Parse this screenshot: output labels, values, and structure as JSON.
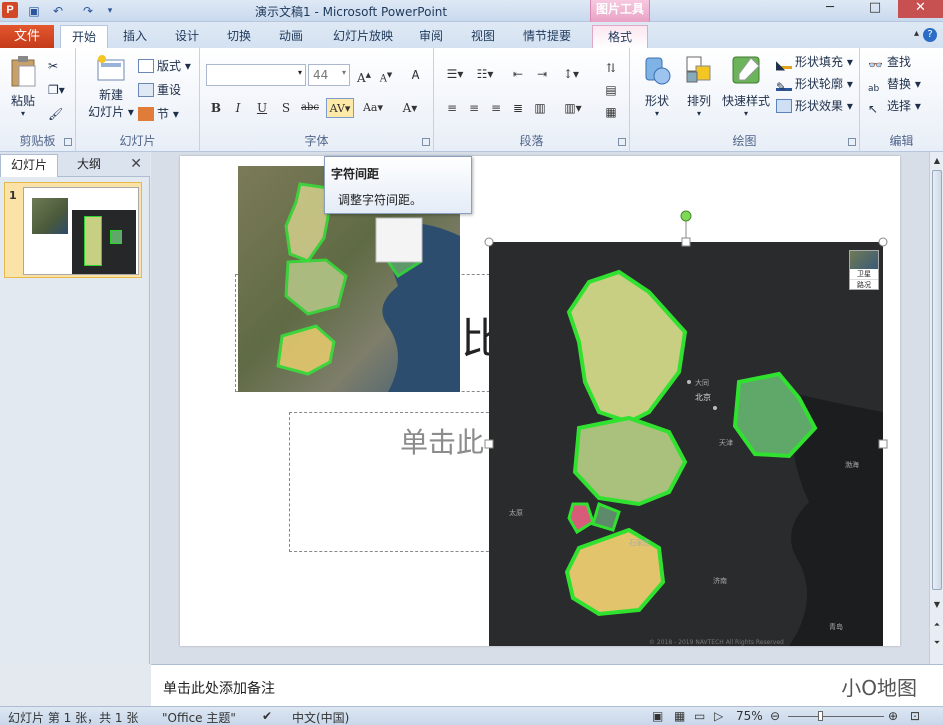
{
  "window": {
    "title": "演示文稿1 - Microsoft PowerPoint",
    "contextual_group": "图片工具"
  },
  "tabs": {
    "file": "文件",
    "items": [
      "开始",
      "插入",
      "设计",
      "切换",
      "动画",
      "幻灯片放映",
      "审阅",
      "视图",
      "情节提要",
      "格式"
    ]
  },
  "ribbon": {
    "clipboard": {
      "label": "剪贴板",
      "paste": "粘贴"
    },
    "slides": {
      "label": "幻灯片",
      "new_slide_1": "新建",
      "new_slide_2": "幻灯片",
      "layout": "版式",
      "reset": "重设",
      "section": "节"
    },
    "font": {
      "label": "字体",
      "name_value": "",
      "size_value": "44"
    },
    "paragraph": {
      "label": "段落"
    },
    "drawing": {
      "label": "绘图",
      "shapes": "形状",
      "arrange": "排列",
      "quick_styles": "快速样式",
      "fill": "形状填充",
      "outline": "形状轮廓",
      "effects": "形状效果"
    },
    "editing": {
      "label": "编辑",
      "find": "查找",
      "replace": "替换",
      "select": "选择"
    }
  },
  "tooltip": {
    "title": "字符间距",
    "body": "调整字符间距。"
  },
  "left_pane": {
    "tab_slides": "幻灯片",
    "tab_outline": "大纲",
    "slide_number": "1"
  },
  "slide": {
    "title_fragment": "比",
    "subtitle_fragment": "单击此",
    "map_overlay": {
      "layer_satellite": "卫星",
      "layer_roads": "路况",
      "city_labels": [
        "北京",
        "天津",
        "大同",
        "太原",
        "石家庄",
        "济南",
        "青岛",
        "渤海"
      ],
      "attribution": "© 2018 - 2019 NAVTECH All Rights Reserved"
    }
  },
  "notes": {
    "placeholder": "单击此处添加备注",
    "watermark": "小O地图"
  },
  "status": {
    "slide_info": "幻灯片 第 1 张，共 1 张",
    "theme": "\"Office 主题\"",
    "language": "中文(中国)",
    "zoom": "75%"
  }
}
